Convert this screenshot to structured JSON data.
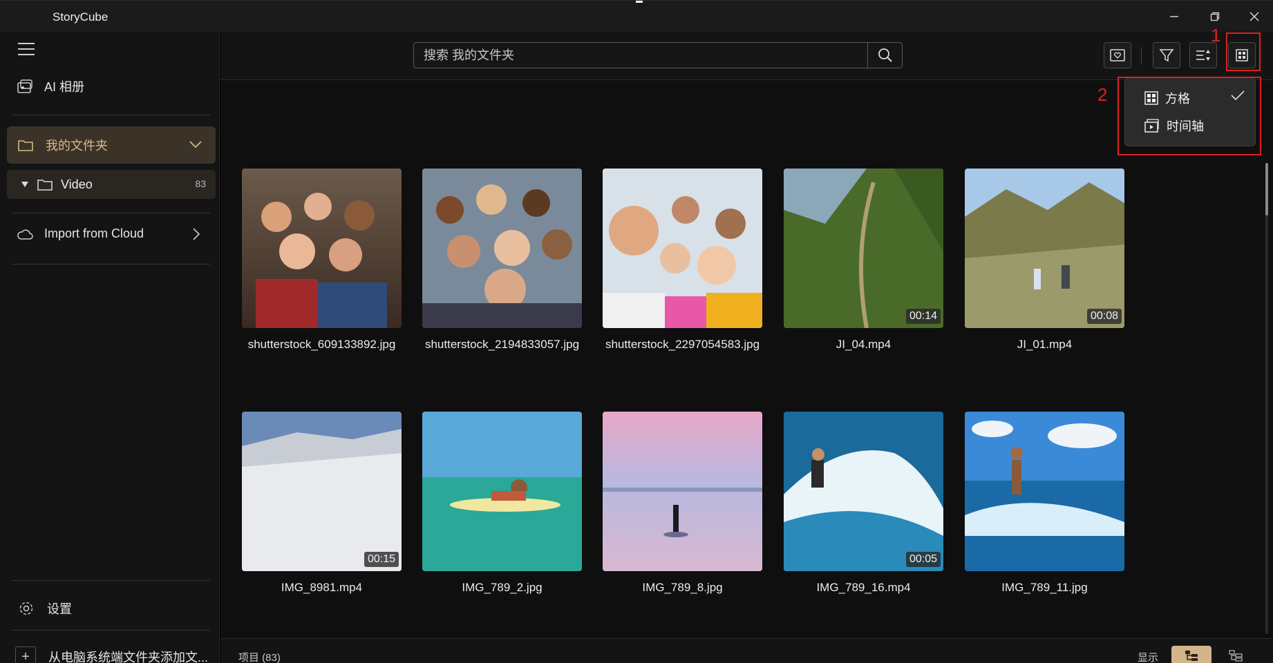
{
  "window": {
    "title": "StoryCube"
  },
  "sidebar": {
    "ai_album": "AI 相册",
    "my_folders": "我的文件夹",
    "video_folder": {
      "label": "Video",
      "count": "83"
    },
    "import_cloud": "Import from Cloud",
    "settings": "设置",
    "add_folder": "从电脑系统端文件夹添加文..."
  },
  "toolbar": {
    "search_placeholder": "搜索 我的文件夹",
    "annotation_1": "1",
    "annotation_2": "2"
  },
  "view_menu": {
    "grid_label": "方格",
    "timeline_label": "时间轴",
    "selected": "grid"
  },
  "items": [
    {
      "name": "shutterstock_609133892.jpg",
      "duration": "",
      "kind": "people"
    },
    {
      "name": "shutterstock_2194833057.jpg",
      "duration": "",
      "kind": "people"
    },
    {
      "name": "shutterstock_2297054583.jpg",
      "duration": "",
      "kind": "people"
    },
    {
      "name": "JI_04.mp4",
      "duration": "00:14",
      "kind": "mountain"
    },
    {
      "name": "JI_01.mp4",
      "duration": "00:08",
      "kind": "mountain"
    },
    {
      "name": "IMG_8981.mp4",
      "duration": "00:15",
      "kind": "snow"
    },
    {
      "name": "IMG_789_2.jpg",
      "duration": "",
      "kind": "sea"
    },
    {
      "name": "IMG_789_8.jpg",
      "duration": "",
      "kind": "sunset"
    },
    {
      "name": "IMG_789_16.mp4",
      "duration": "00:05",
      "kind": "wave"
    },
    {
      "name": "IMG_789_11.jpg",
      "duration": "",
      "kind": "wave"
    }
  ],
  "status": {
    "items_label": "项目 (83)",
    "show_label": "显示"
  },
  "colors": {
    "accent": "#d4b48a",
    "selected_folder_bg": "#3b3328",
    "annotation_red": "#e02020"
  }
}
